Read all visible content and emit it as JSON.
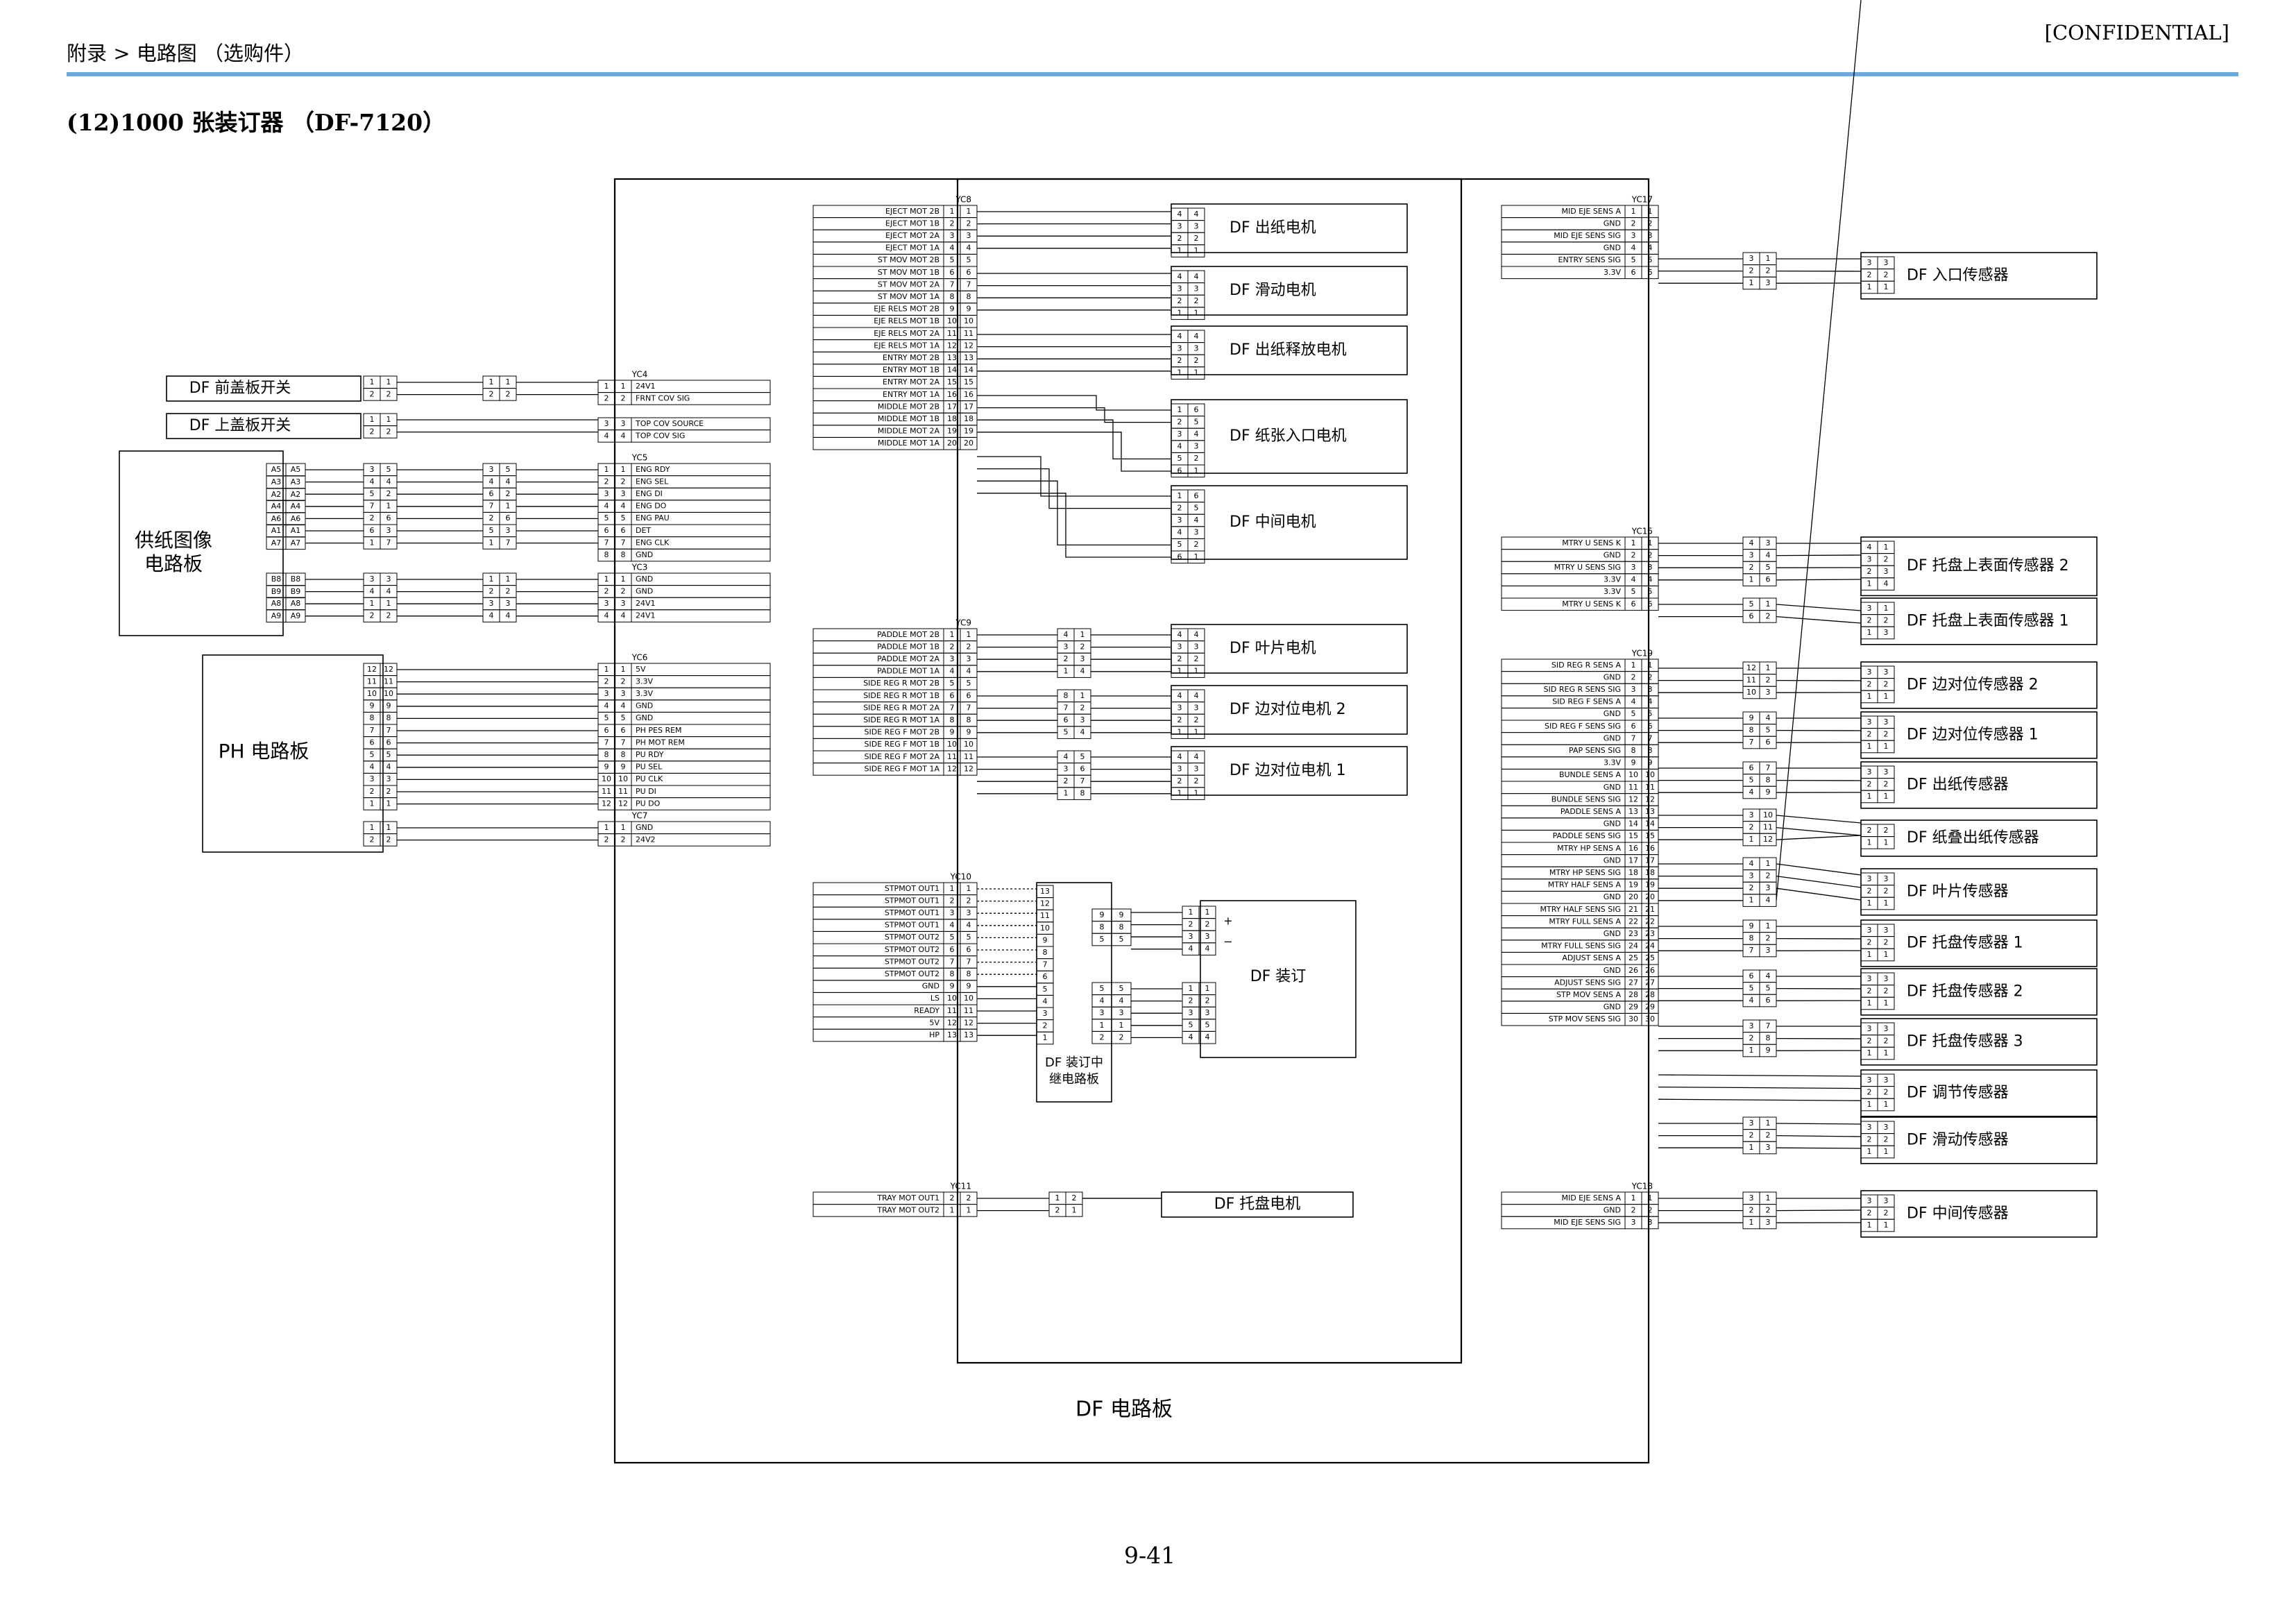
{
  "header": {
    "breadcrumb": "附录 > 电路图 （选购件）",
    "confidential": "[CONFIDENTIAL]"
  },
  "title": "(12)1000 张装订器 （DF-7120）",
  "page_number": "9-41",
  "main_board": "DF 电路板",
  "left_groups": [
    {
      "name": "YC4",
      "rows": [
        [
          "1",
          "1",
          "24V1"
        ],
        [
          "2",
          "2",
          "FRNT COV SIG"
        ]
      ],
      "gap": true
    },
    {
      "name": "",
      "rows": [
        [
          "3",
          "3",
          "TOP COV SOURCE"
        ],
        [
          "4",
          "4",
          "TOP COV SIG"
        ]
      ]
    },
    {
      "name": "YC5",
      "rows": [
        [
          "1",
          "1",
          "ENG RDY"
        ],
        [
          "2",
          "2",
          "ENG SEL"
        ],
        [
          "3",
          "3",
          "ENG DI"
        ],
        [
          "4",
          "4",
          "ENG DO"
        ],
        [
          "5",
          "5",
          "ENG PAU"
        ],
        [
          "6",
          "6",
          "DET"
        ],
        [
          "7",
          "7",
          "ENG CLK"
        ],
        [
          "8",
          "8",
          "GND"
        ]
      ]
    },
    {
      "name": "YC3",
      "rows": [
        [
          "1",
          "1",
          "GND"
        ],
        [
          "2",
          "2",
          "GND"
        ],
        [
          "3",
          "3",
          "24V1"
        ],
        [
          "4",
          "4",
          "24V1"
        ]
      ]
    },
    {
      "name": "YC6",
      "rows": [
        [
          "1",
          "1",
          "5V"
        ],
        [
          "2",
          "2",
          "3.3V"
        ],
        [
          "3",
          "3",
          "3.3V"
        ],
        [
          "4",
          "4",
          "GND"
        ],
        [
          "5",
          "5",
          "GND"
        ],
        [
          "6",
          "6",
          "PH PES REM"
        ],
        [
          "7",
          "7",
          "PH MOT REM"
        ],
        [
          "8",
          "8",
          "PU RDY"
        ],
        [
          "9",
          "9",
          "PU SEL"
        ],
        [
          "10",
          "10",
          "PU CLK"
        ],
        [
          "11",
          "11",
          "PU DI"
        ],
        [
          "12",
          "12",
          "PU DO"
        ]
      ]
    },
    {
      "name": "YC7",
      "rows": [
        [
          "1",
          "1",
          "GND"
        ],
        [
          "2",
          "2",
          "24V2"
        ]
      ]
    }
  ],
  "left_devices": [
    {
      "label": "DF 前盖板开关"
    },
    {
      "label": "DF 上盖板开关"
    },
    {
      "label": "供纸图像\n电路板"
    },
    {
      "label": "PH 电路板"
    }
  ],
  "paper_feed_pins": [
    "A5",
    "A3",
    "A2",
    "A4",
    "A6",
    "A1",
    "A7",
    "B8",
    "B9",
    "A8",
    "A9"
  ],
  "yc8": {
    "name": "YC8",
    "rows": [
      [
        "EJECT MOT 2B",
        "1"
      ],
      [
        "EJECT MOT 1B",
        "2"
      ],
      [
        "EJECT MOT 2A",
        "3"
      ],
      [
        "EJECT MOT 1A",
        "4"
      ],
      [
        "ST MOV MOT 2B",
        "5"
      ],
      [
        "ST MOV MOT 1B",
        "6"
      ],
      [
        "ST MOV MOT 2A",
        "7"
      ],
      [
        "ST MOV MOT 1A",
        "8"
      ],
      [
        "EJE RELS MOT 2B",
        "9"
      ],
      [
        "EJE RELS MOT 1B",
        "10"
      ],
      [
        "EJE RELS MOT 2A",
        "11"
      ],
      [
        "EJE RELS MOT 1A",
        "12"
      ],
      [
        "ENTRY MOT 2B",
        "13"
      ],
      [
        "ENTRY MOT 1B",
        "14"
      ],
      [
        "ENTRY MOT 2A",
        "15"
      ],
      [
        "ENTRY MOT 1A",
        "16"
      ],
      [
        "MIDDLE MOT 2B",
        "17"
      ],
      [
        "MIDDLE MOT 1B",
        "18"
      ],
      [
        "MIDDLE MOT 2A",
        "19"
      ],
      [
        "MIDDLE MOT 1A",
        "20"
      ]
    ]
  },
  "yc9": {
    "name": "YC9",
    "rows": [
      [
        "PADDLE MOT 2B",
        "1"
      ],
      [
        "PADDLE MOT 1B",
        "2"
      ],
      [
        "PADDLE MOT 2A",
        "3"
      ],
      [
        "PADDLE MOT 1A",
        "4"
      ],
      [
        "SIDE REG R MOT 2B",
        "5"
      ],
      [
        "SIDE REG R MOT 1B",
        "6"
      ],
      [
        "SIDE REG R MOT 2A",
        "7"
      ],
      [
        "SIDE REG R MOT 1A",
        "8"
      ],
      [
        "SIDE REG F MOT 2B",
        "9"
      ],
      [
        "SIDE REG F MOT 1B",
        "10"
      ],
      [
        "SIDE REG F MOT 2A",
        "11"
      ],
      [
        "SIDE REG F MOT 1A",
        "12"
      ]
    ]
  },
  "yc10": {
    "name": "YC10",
    "rows": [
      [
        "STPMOT OUT1",
        "1"
      ],
      [
        "STPMOT OUT1",
        "2"
      ],
      [
        "STPMOT OUT1",
        "3"
      ],
      [
        "STPMOT OUT1",
        "4"
      ],
      [
        "STPMOT OUT2",
        "5"
      ],
      [
        "STPMOT OUT2",
        "6"
      ],
      [
        "STPMOT OUT2",
        "7"
      ],
      [
        "STPMOT OUT2",
        "8"
      ],
      [
        "GND",
        "9"
      ],
      [
        "LS",
        "10"
      ],
      [
        "READY",
        "11"
      ],
      [
        "5V",
        "12"
      ],
      [
        "HP",
        "13"
      ]
    ]
  },
  "yc11": {
    "name": "YC11",
    "rows": [
      [
        "TRAY MOT OUT1",
        "2"
      ],
      [
        "TRAY MOT OUT2",
        "1"
      ]
    ]
  },
  "middle_motors": [
    {
      "label": "DF 出纸电机"
    },
    {
      "label": "DF 滑动电机"
    },
    {
      "label": "DF 出纸释放电机"
    },
    {
      "label": "DF 纸张入口电机"
    },
    {
      "label": "DF 中间电机"
    },
    {
      "label": "DF 叶片电机"
    },
    {
      "label": "DF 边对位电机 2"
    },
    {
      "label": "DF 边对位电机 1"
    },
    {
      "label": "DF 装订"
    },
    {
      "label": "DF 托盘电机"
    }
  ],
  "relay_board": "DF 装订中\n继电路板",
  "staple_pins": [
    "13",
    "12",
    "11",
    "10",
    "9",
    "8",
    "7",
    "6",
    "5",
    "4",
    "3",
    "2",
    "1"
  ],
  "staple_marks": [
    "+",
    "−"
  ],
  "yc17": {
    "name": "YC17",
    "rows": [
      [
        "MID EJE SENS A",
        "1"
      ],
      [
        "GND",
        "2"
      ],
      [
        "MID EJE SENS SIG",
        "3"
      ],
      [
        "GND",
        "4"
      ],
      [
        "ENTRY SENS SIG",
        "5"
      ],
      [
        "3.3V",
        "6"
      ]
    ]
  },
  "yc15": {
    "name": "YC15",
    "rows": [
      [
        "MTRY U SENS K",
        "1"
      ],
      [
        "GND",
        "2"
      ],
      [
        "MTRY U SENS SIG",
        "3"
      ],
      [
        "3.3V",
        "4"
      ],
      [
        "3.3V",
        "5"
      ],
      [
        "MTRY U SENS K",
        "6"
      ]
    ]
  },
  "yc19": {
    "name": "YC19",
    "rows": [
      [
        "SID REG R SENS A",
        "1"
      ],
      [
        "GND",
        "2"
      ],
      [
        "SID REG R SENS SIG",
        "3"
      ],
      [
        "SID REG F SENS A",
        "4"
      ],
      [
        "GND",
        "5"
      ],
      [
        "SID REG F SENS SIG",
        "6"
      ],
      [
        "GND",
        "7"
      ],
      [
        "PAP SENS SIG",
        "8"
      ],
      [
        "3.3V",
        "9"
      ],
      [
        "BUNDLE SENS A",
        "10"
      ],
      [
        "GND",
        "11"
      ],
      [
        "BUNDLE SENS SIG",
        "12"
      ],
      [
        "PADDLE SENS A",
        "13"
      ],
      [
        "GND",
        "14"
      ],
      [
        "PADDLE SENS SIG",
        "15"
      ],
      [
        "MTRY HP SENS A",
        "16"
      ],
      [
        "GND",
        "17"
      ],
      [
        "MTRY HP SENS SIG",
        "18"
      ],
      [
        "MTRY HALF SENS A",
        "19"
      ],
      [
        "GND",
        "20"
      ],
      [
        "MTRY HALF SENS SIG",
        "21"
      ],
      [
        "MTRY FULL SENS A",
        "22"
      ],
      [
        "GND",
        "23"
      ],
      [
        "MTRY FULL SENS SIG",
        "24"
      ],
      [
        "ADJUST SENS A",
        "25"
      ],
      [
        "GND",
        "26"
      ],
      [
        "ADJUST SENS SIG",
        "27"
      ],
      [
        "STP MOV SENS A",
        "28"
      ],
      [
        "GND",
        "29"
      ],
      [
        "STP MOV SENS SIG",
        "30"
      ]
    ]
  },
  "yc18": {
    "name": "YC18",
    "rows": [
      [
        "MID EJE SENS A",
        "1"
      ],
      [
        "GND",
        "2"
      ],
      [
        "MID EJE SENS SIG",
        "3"
      ]
    ]
  },
  "right_sensors": [
    {
      "label": "DF 入口传感器"
    },
    {
      "label": "DF 托盘上表面传感器 2"
    },
    {
      "label": "DF 托盘上表面传感器 1"
    },
    {
      "label": "DF 边对位传感器 2"
    },
    {
      "label": "DF 边对位传感器 1"
    },
    {
      "label": "DF 出纸传感器"
    },
    {
      "label": "DF 纸叠出纸传感器"
    },
    {
      "label": "DF 叶片传感器"
    },
    {
      "label": "DF 托盘传感器 1"
    },
    {
      "label": "DF 托盘传感器 2"
    },
    {
      "label": "DF 托盘传感器 3"
    },
    {
      "label": "DF 调节传感器"
    },
    {
      "label": "DF 滑动传感器"
    },
    {
      "label": "DF 中间传感器"
    }
  ]
}
